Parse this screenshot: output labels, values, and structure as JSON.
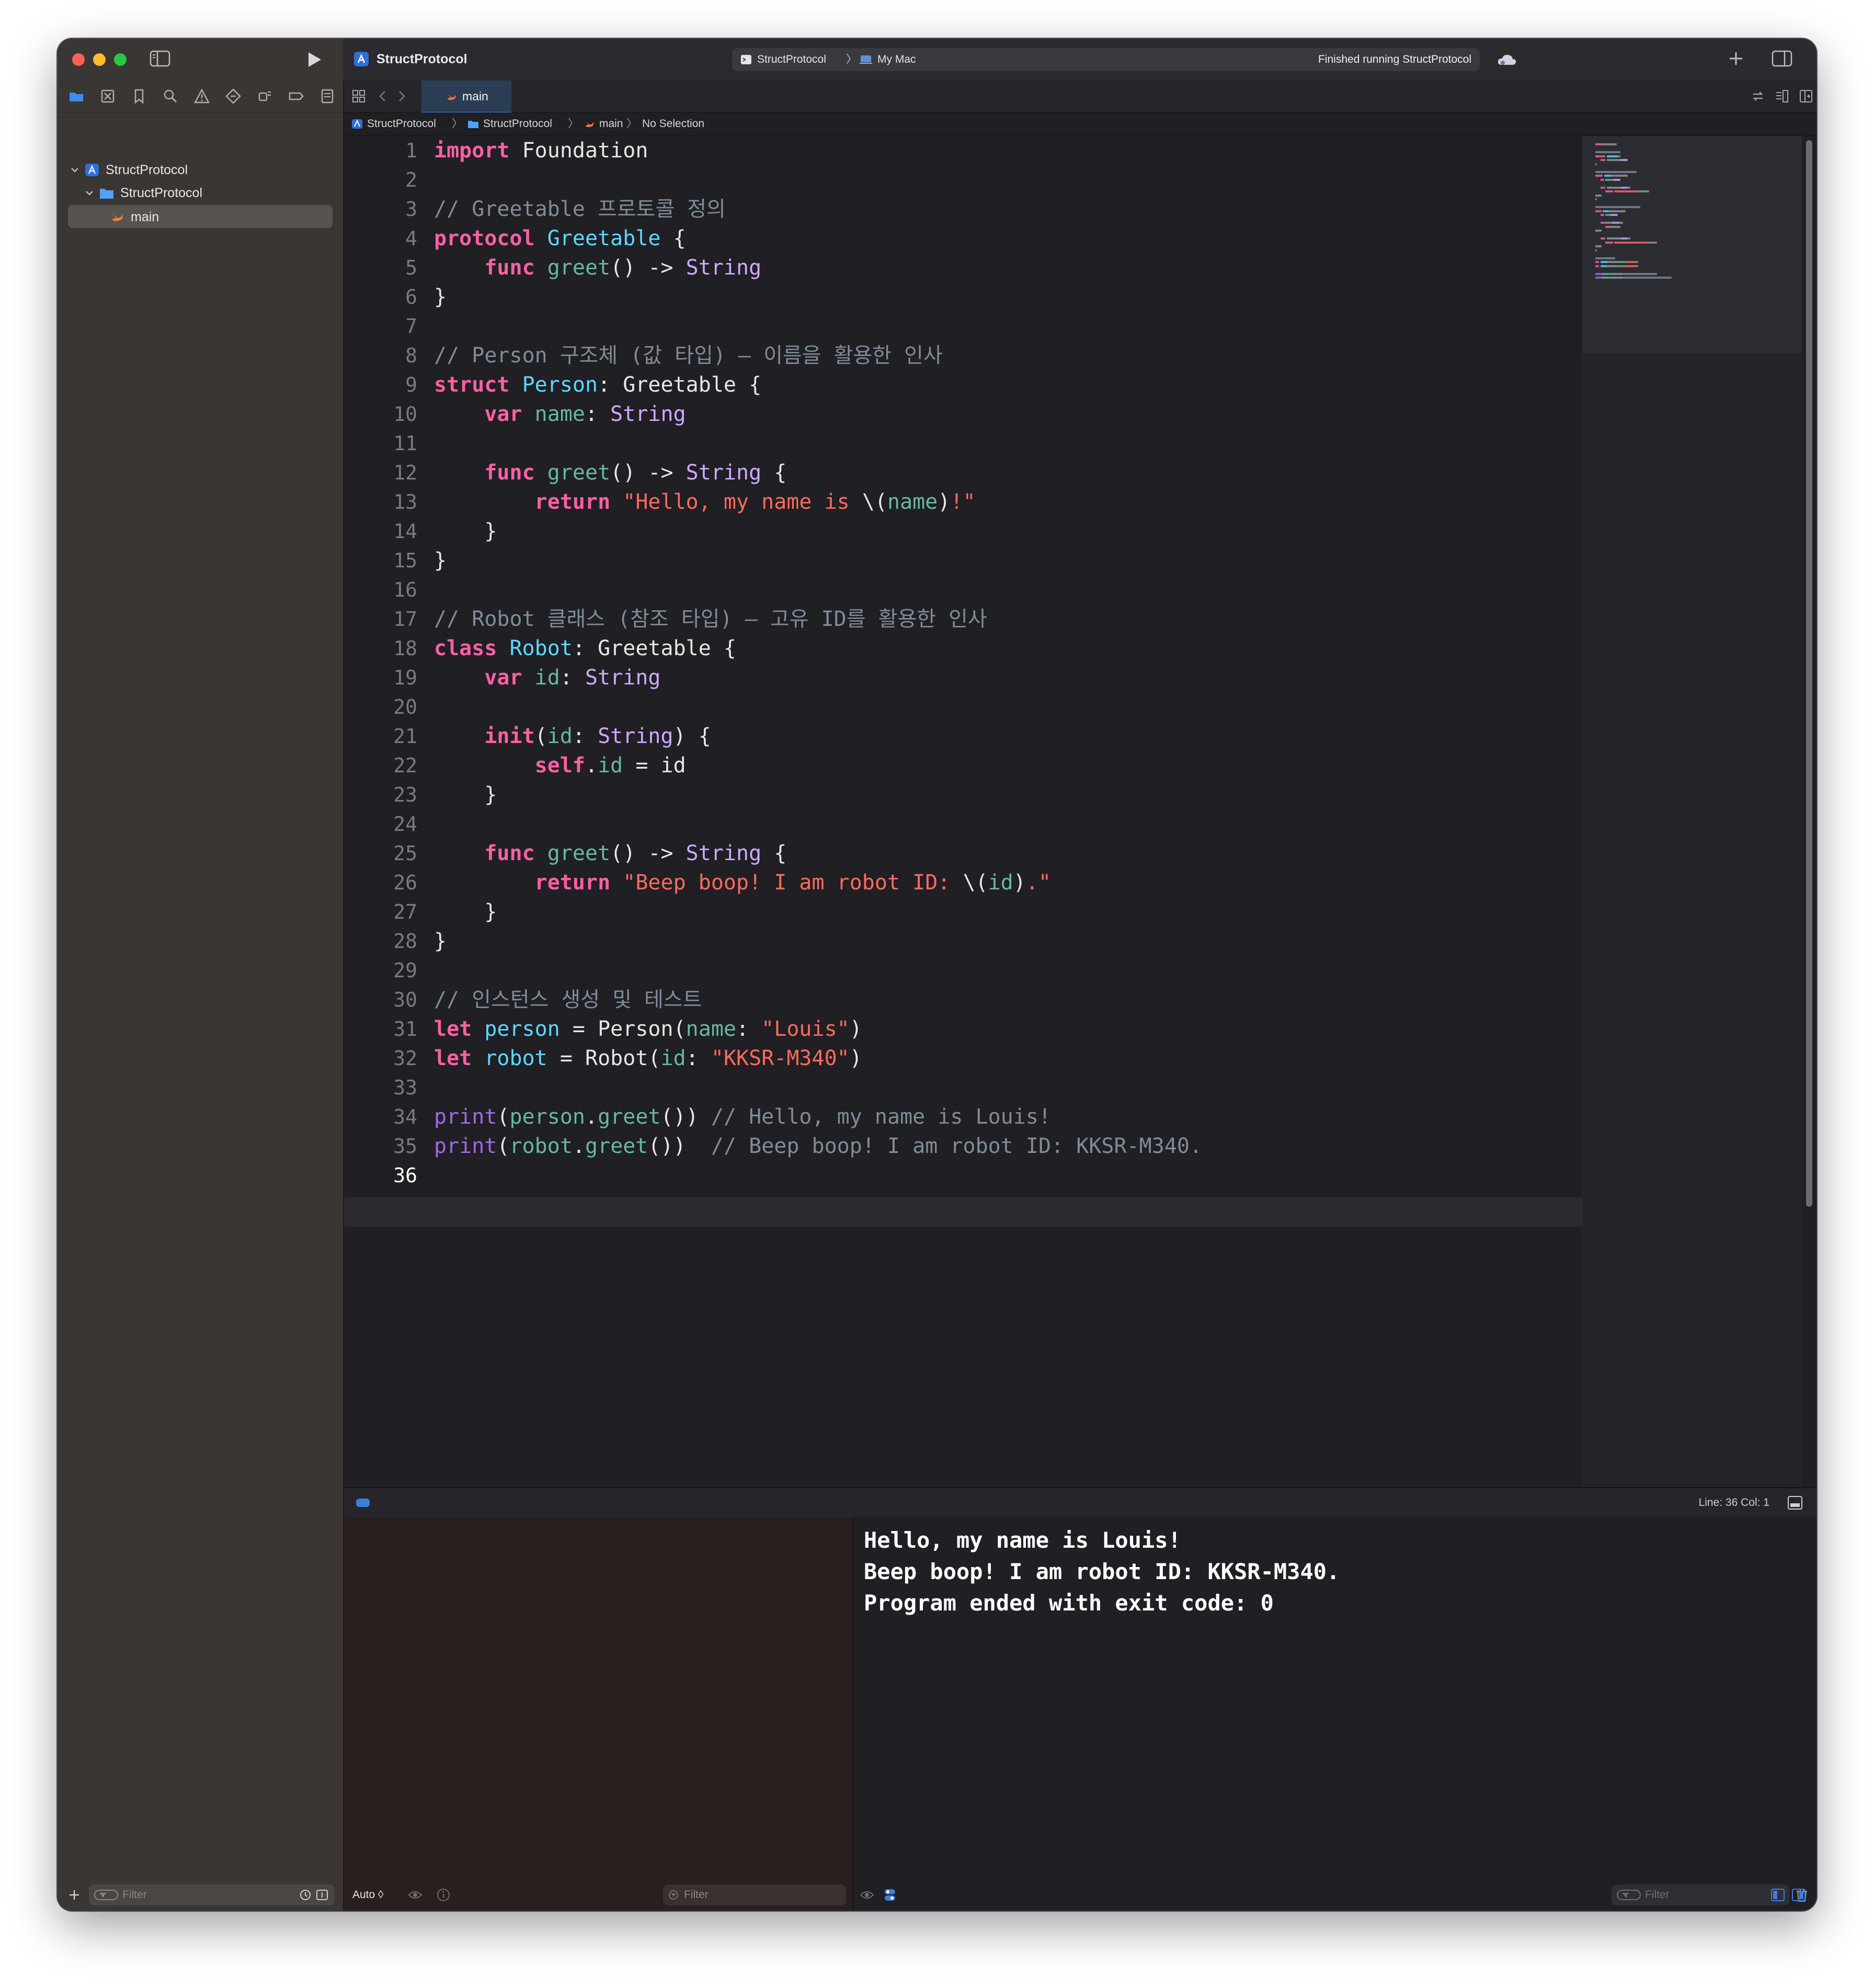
{
  "toolbar": {
    "project_title": "StructProtocol",
    "scheme": "StructProtocol",
    "destination": "My Mac",
    "status": "Finished running StructProtocol",
    "breadcrumb_separator": "〉"
  },
  "navigator": {
    "tabs": [
      "folder-icon",
      "source-control-icon",
      "bookmark-icon",
      "search-icon",
      "warning-icon",
      "test-icon",
      "debug-icon",
      "breakpoint-icon",
      "report-icon"
    ],
    "tree": [
      {
        "label": "StructProtocol",
        "kind": "project"
      },
      {
        "label": "StructProtocol",
        "kind": "folder"
      },
      {
        "label": "main",
        "kind": "swift-file",
        "selected": true
      }
    ],
    "filter_placeholder": "Filter"
  },
  "editor": {
    "tab_label": "main",
    "jumpbar": [
      "StructProtocol",
      "StructProtocol",
      "main",
      "No Selection"
    ],
    "current_line": 36,
    "lines": [
      [
        [
          "kw",
          "import"
        ],
        [
          "tx",
          " Foundation"
        ]
      ],
      [],
      [
        [
          "cm",
          "// Greetable 프로토콜 정의"
        ]
      ],
      [
        [
          "kw",
          "protocol"
        ],
        [
          "tx",
          " "
        ],
        [
          "ty",
          "Greetable"
        ],
        [
          "tx",
          " {"
        ]
      ],
      [
        [
          "tx",
          "    "
        ],
        [
          "kw",
          "func"
        ],
        [
          "tx",
          " "
        ],
        [
          "fn",
          "greet"
        ],
        [
          "tx",
          "() -> "
        ],
        [
          "pt",
          "String"
        ]
      ],
      [
        [
          "tx",
          "}"
        ]
      ],
      [],
      [
        [
          "cm",
          "// Person 구조체 (값 타입) – 이름을 활용한 인사"
        ]
      ],
      [
        [
          "kw",
          "struct"
        ],
        [
          "tx",
          " "
        ],
        [
          "ty",
          "Person"
        ],
        [
          "tx",
          ": "
        ],
        [
          "tx",
          "Greetable {"
        ]
      ],
      [
        [
          "tx",
          "    "
        ],
        [
          "kw",
          "var"
        ],
        [
          "tx",
          " "
        ],
        [
          "fn",
          "name"
        ],
        [
          "tx",
          ": "
        ],
        [
          "pt",
          "String"
        ]
      ],
      [],
      [
        [
          "tx",
          "    "
        ],
        [
          "kw",
          "func"
        ],
        [
          "tx",
          " "
        ],
        [
          "fn",
          "greet"
        ],
        [
          "tx",
          "() -> "
        ],
        [
          "pt",
          "String"
        ],
        [
          "tx",
          " {"
        ]
      ],
      [
        [
          "tx",
          "        "
        ],
        [
          "kw",
          "return"
        ],
        [
          "tx",
          " "
        ],
        [
          "st",
          "\"Hello, my name is "
        ],
        [
          "tx",
          "\\("
        ],
        [
          "fn",
          "name"
        ],
        [
          "tx",
          ")"
        ],
        [
          "st",
          "!\""
        ]
      ],
      [
        [
          "tx",
          "    }"
        ]
      ],
      [
        [
          "tx",
          "}"
        ]
      ],
      [],
      [
        [
          "cm",
          "// Robot 클래스 (참조 타입) – 고유 ID를 활용한 인사"
        ]
      ],
      [
        [
          "kw",
          "class"
        ],
        [
          "tx",
          " "
        ],
        [
          "ty",
          "Robot"
        ],
        [
          "tx",
          ": Greetable {"
        ]
      ],
      [
        [
          "tx",
          "    "
        ],
        [
          "kw",
          "var"
        ],
        [
          "tx",
          " "
        ],
        [
          "fn",
          "id"
        ],
        [
          "tx",
          ": "
        ],
        [
          "pt",
          "String"
        ]
      ],
      [],
      [
        [
          "tx",
          "    "
        ],
        [
          "kw",
          "init"
        ],
        [
          "tx",
          "("
        ],
        [
          "fn",
          "id"
        ],
        [
          "tx",
          ": "
        ],
        [
          "pt",
          "String"
        ],
        [
          "tx",
          ") {"
        ]
      ],
      [
        [
          "tx",
          "        "
        ],
        [
          "kw",
          "self"
        ],
        [
          "tx",
          "."
        ],
        [
          "fn",
          "id"
        ],
        [
          "tx",
          " = id"
        ]
      ],
      [
        [
          "tx",
          "    }"
        ]
      ],
      [],
      [
        [
          "tx",
          "    "
        ],
        [
          "kw",
          "func"
        ],
        [
          "tx",
          " "
        ],
        [
          "fn",
          "greet"
        ],
        [
          "tx",
          "() -> "
        ],
        [
          "pt",
          "String"
        ],
        [
          "tx",
          " {"
        ]
      ],
      [
        [
          "tx",
          "        "
        ],
        [
          "kw",
          "return"
        ],
        [
          "tx",
          " "
        ],
        [
          "st",
          "\"Beep boop! I am robot ID: "
        ],
        [
          "tx",
          "\\("
        ],
        [
          "fn",
          "id"
        ],
        [
          "tx",
          ")"
        ],
        [
          "st",
          ".\""
        ]
      ],
      [
        [
          "tx",
          "    }"
        ]
      ],
      [
        [
          "tx",
          "}"
        ]
      ],
      [],
      [
        [
          "cm",
          "// 인스턴스 생성 및 테스트"
        ]
      ],
      [
        [
          "kw",
          "let"
        ],
        [
          "tx",
          " "
        ],
        [
          "ty",
          "person"
        ],
        [
          "tx",
          " = Person("
        ],
        [
          "fn",
          "name"
        ],
        [
          "tx",
          ": "
        ],
        [
          "st",
          "\"Louis\""
        ],
        [
          "tx",
          ")"
        ]
      ],
      [
        [
          "kw",
          "let"
        ],
        [
          "tx",
          " "
        ],
        [
          "ty",
          "robot"
        ],
        [
          "tx",
          " = Robot("
        ],
        [
          "fn",
          "id"
        ],
        [
          "tx",
          ": "
        ],
        [
          "st",
          "\"KKSR-M340\""
        ],
        [
          "tx",
          ")"
        ]
      ],
      [],
      [
        [
          "pr",
          "print"
        ],
        [
          "tx",
          "("
        ],
        [
          "fn",
          "person"
        ],
        [
          "tx",
          "."
        ],
        [
          "fn",
          "greet"
        ],
        [
          "tx",
          "()) "
        ],
        [
          "cm",
          "// Hello, my name is Louis!"
        ]
      ],
      [
        [
          "pr",
          "print"
        ],
        [
          "tx",
          "("
        ],
        [
          "fn",
          "robot"
        ],
        [
          "tx",
          "."
        ],
        [
          "fn",
          "greet"
        ],
        [
          "tx",
          "())  "
        ],
        [
          "cm",
          "// Beep boop! I am robot ID: KKSR-M340."
        ]
      ],
      []
    ]
  },
  "debug": {
    "cursor_position": "Line: 36  Col: 1",
    "auto_label": "Auto ◊",
    "filter_placeholder": "Filter"
  },
  "console": {
    "output": [
      "Hello, my name is Louis!",
      "Beep boop! I am robot ID: KKSR-M340.",
      "Program ended with exit code: 0"
    ]
  },
  "colors": {
    "keyword": "#fc5fa3",
    "type": "#5dd8ff",
    "string": "#fc6a5d",
    "comment": "#7f8c98",
    "accent": "#3d7de0"
  }
}
